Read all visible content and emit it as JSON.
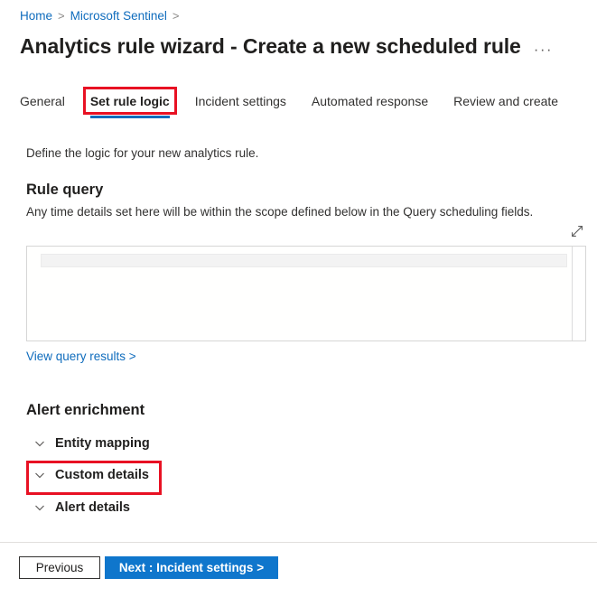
{
  "breadcrumb": {
    "items": [
      {
        "label": "Home",
        "separator": ">"
      },
      {
        "label": "Microsoft Sentinel",
        "separator": ">"
      }
    ],
    "link_color": "#0f6cbd"
  },
  "header": {
    "title": "Analytics rule wizard - Create a new scheduled rule",
    "more_label": "···",
    "more_icon": "ellipsis-icon"
  },
  "tabs": {
    "selected_index": 1,
    "accent_color": "#0f6cbd",
    "annotation_color": "#e81123",
    "items": [
      {
        "label": "General"
      },
      {
        "label": "Set rule logic"
      },
      {
        "label": "Incident settings"
      },
      {
        "label": "Automated response"
      },
      {
        "label": "Review and create"
      }
    ]
  },
  "main": {
    "intro": "Define the logic for your new analytics rule.",
    "rule_query": {
      "heading": "Rule query",
      "subtext": "Any time details set here will be within the scope defined below in the Query scheduling fields.",
      "expand_icon": "expand-diagonal-icon",
      "query_value": "",
      "query_placeholder": "",
      "results_link": "View query results >"
    },
    "alert_enrichment": {
      "heading": "Alert enrichment",
      "sections": [
        {
          "label": "Entity mapping",
          "icon": "chevron-down-icon",
          "expanded": false,
          "annotated": false
        },
        {
          "label": "Custom details",
          "icon": "chevron-down-icon",
          "expanded": false,
          "annotated": true
        },
        {
          "label": "Alert details",
          "icon": "chevron-down-icon",
          "expanded": false,
          "annotated": false
        }
      ]
    }
  },
  "footer": {
    "previous_label": "Previous",
    "next_label": "Next : Incident settings >",
    "primary_color": "#0f76cc"
  }
}
